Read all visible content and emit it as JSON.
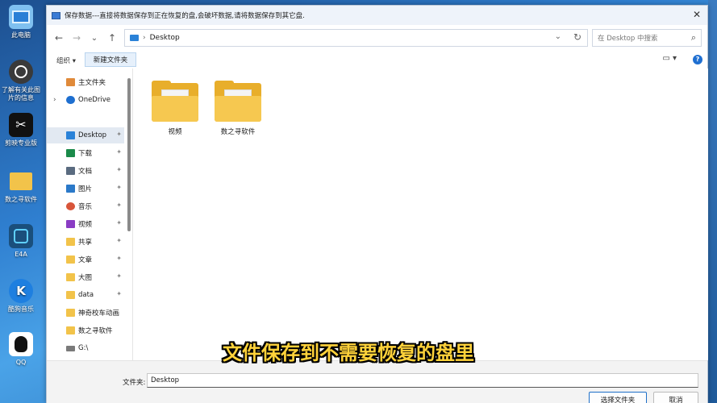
{
  "desktop": {
    "icons": [
      {
        "label": "此电脑",
        "icon": "computer-icon"
      },
      {
        "label": "了解有关此图片的信息",
        "icon": "info-camera-icon"
      },
      {
        "label": "剪映专业版",
        "icon": "capcut-icon"
      },
      {
        "label": "数之寻软件",
        "icon": "folder-icon"
      },
      {
        "label": "E4A",
        "icon": "e4a-icon"
      },
      {
        "label": "酷狗音乐",
        "icon": "kugou-icon"
      },
      {
        "label": "QQ",
        "icon": "qq-icon"
      }
    ]
  },
  "dialog": {
    "title": "保存数据---直接将数据保存到正在恢复的盘,会破坏数据,请将数据保存到其它盘.",
    "close_glyph": "✕",
    "nav": {
      "back": "←",
      "forward": "→",
      "history": "⌄",
      "up": "↑",
      "address_separator": "›",
      "address_location": "Desktop",
      "address_dropdown": "⌄",
      "refresh": "↻",
      "search_placeholder": "在 Desktop 中搜索",
      "search_glyph": "⌕"
    },
    "toolbar": {
      "organize_label": "组织 ▾",
      "new_folder_label": "新建文件夹",
      "view_label": "▭ ▾",
      "help_label": "?"
    },
    "sidebar": {
      "items": [
        {
          "label": "主文件夹",
          "icon": "home-icon",
          "color": "#e08a3a",
          "pinned": false
        },
        {
          "label": "OneDrive",
          "icon": "cloud-icon",
          "color": "#1e6fd0",
          "pinned": false,
          "expander": "›"
        },
        {
          "label": "Desktop",
          "icon": "desktop-icon",
          "color": "#2a82d8",
          "pinned": true,
          "selected": true
        },
        {
          "label": "下载",
          "icon": "download-icon",
          "color": "#1b8a4a",
          "pinned": true
        },
        {
          "label": "文档",
          "icon": "document-icon",
          "color": "#5a6b80",
          "pinned": true
        },
        {
          "label": "图片",
          "icon": "pictures-icon",
          "color": "#2b79c9",
          "pinned": true
        },
        {
          "label": "音乐",
          "icon": "music-icon",
          "color": "#d8553a",
          "pinned": true
        },
        {
          "label": "视频",
          "icon": "video-icon",
          "color": "#8a3cc4",
          "pinned": true
        },
        {
          "label": "共享",
          "icon": "folder-icon",
          "color": "#f2c34a",
          "pinned": true
        },
        {
          "label": "文章",
          "icon": "folder-icon",
          "color": "#f2c34a",
          "pinned": true
        },
        {
          "label": "大图",
          "icon": "folder-icon",
          "color": "#f2c34a",
          "pinned": true
        },
        {
          "label": "data",
          "icon": "folder-icon",
          "color": "#f2c34a",
          "pinned": true
        },
        {
          "label": "神奇校车动画",
          "icon": "folder-icon",
          "color": "#f2c34a",
          "pinned": false
        },
        {
          "label": "数之寻软件",
          "icon": "folder-icon",
          "color": "#f2c34a",
          "pinned": false
        },
        {
          "label": "G:\\",
          "icon": "drive-icon",
          "color": "#7a7a7a",
          "pinned": false
        }
      ],
      "pin_glyph": "📌"
    },
    "content": {
      "folders": [
        {
          "label": "视频"
        },
        {
          "label": "数之寻软件"
        }
      ]
    },
    "bottom": {
      "filename_label": "文件夹:",
      "filename_value": "Desktop",
      "select_button": "选择文件夹",
      "cancel_button": "取消"
    }
  },
  "subtitle": "文件保存到不需要恢复的盘里"
}
